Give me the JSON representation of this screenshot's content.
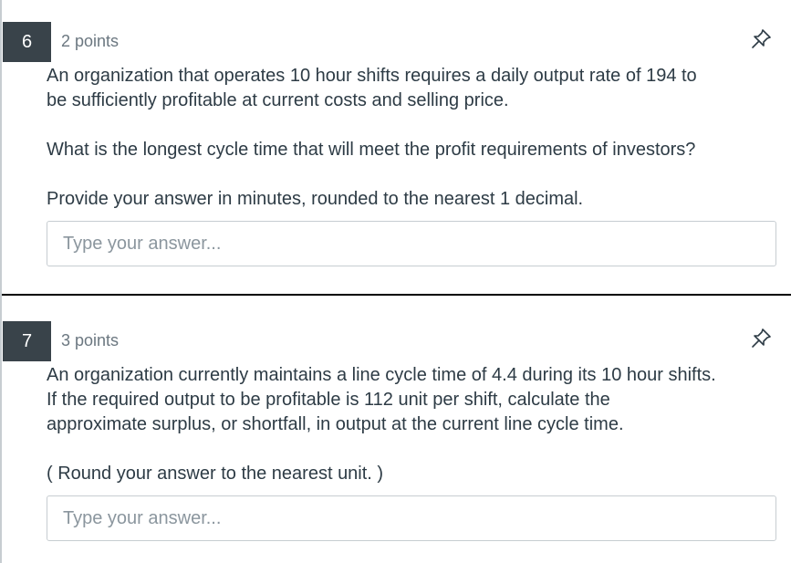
{
  "questions": [
    {
      "number": "6",
      "points": "2 points",
      "pin_icon": "pin-icon",
      "lines": [
        "An organization that operates 10 hour shifts requires a daily output rate of 194 to",
        "be sufficiently profitable at current costs and selling price.",
        "What is the longest cycle time that will meet the profit requirements of investors?",
        "Provide your answer in minutes, rounded to the nearest 1 decimal."
      ],
      "answer": {
        "value": "",
        "placeholder": "Type your answer..."
      }
    },
    {
      "number": "7",
      "points": "3 points",
      "pin_icon": "pin-icon",
      "lines": [
        "An organization currently maintains a line cycle time of 4.4 during its 10 hour shifts.",
        "If the required output to be profitable is 112 unit per shift, calculate the",
        "approximate surplus, or shortfall, in output at the current line cycle time.",
        "( Round your answer to the nearest unit. )"
      ],
      "answer": {
        "value": "",
        "placeholder": "Type your answer..."
      }
    }
  ],
  "colors": {
    "number_badge": "#39434a",
    "text": "#2d3b45",
    "muted": "#6b7780",
    "border": "#c7cdd1"
  }
}
